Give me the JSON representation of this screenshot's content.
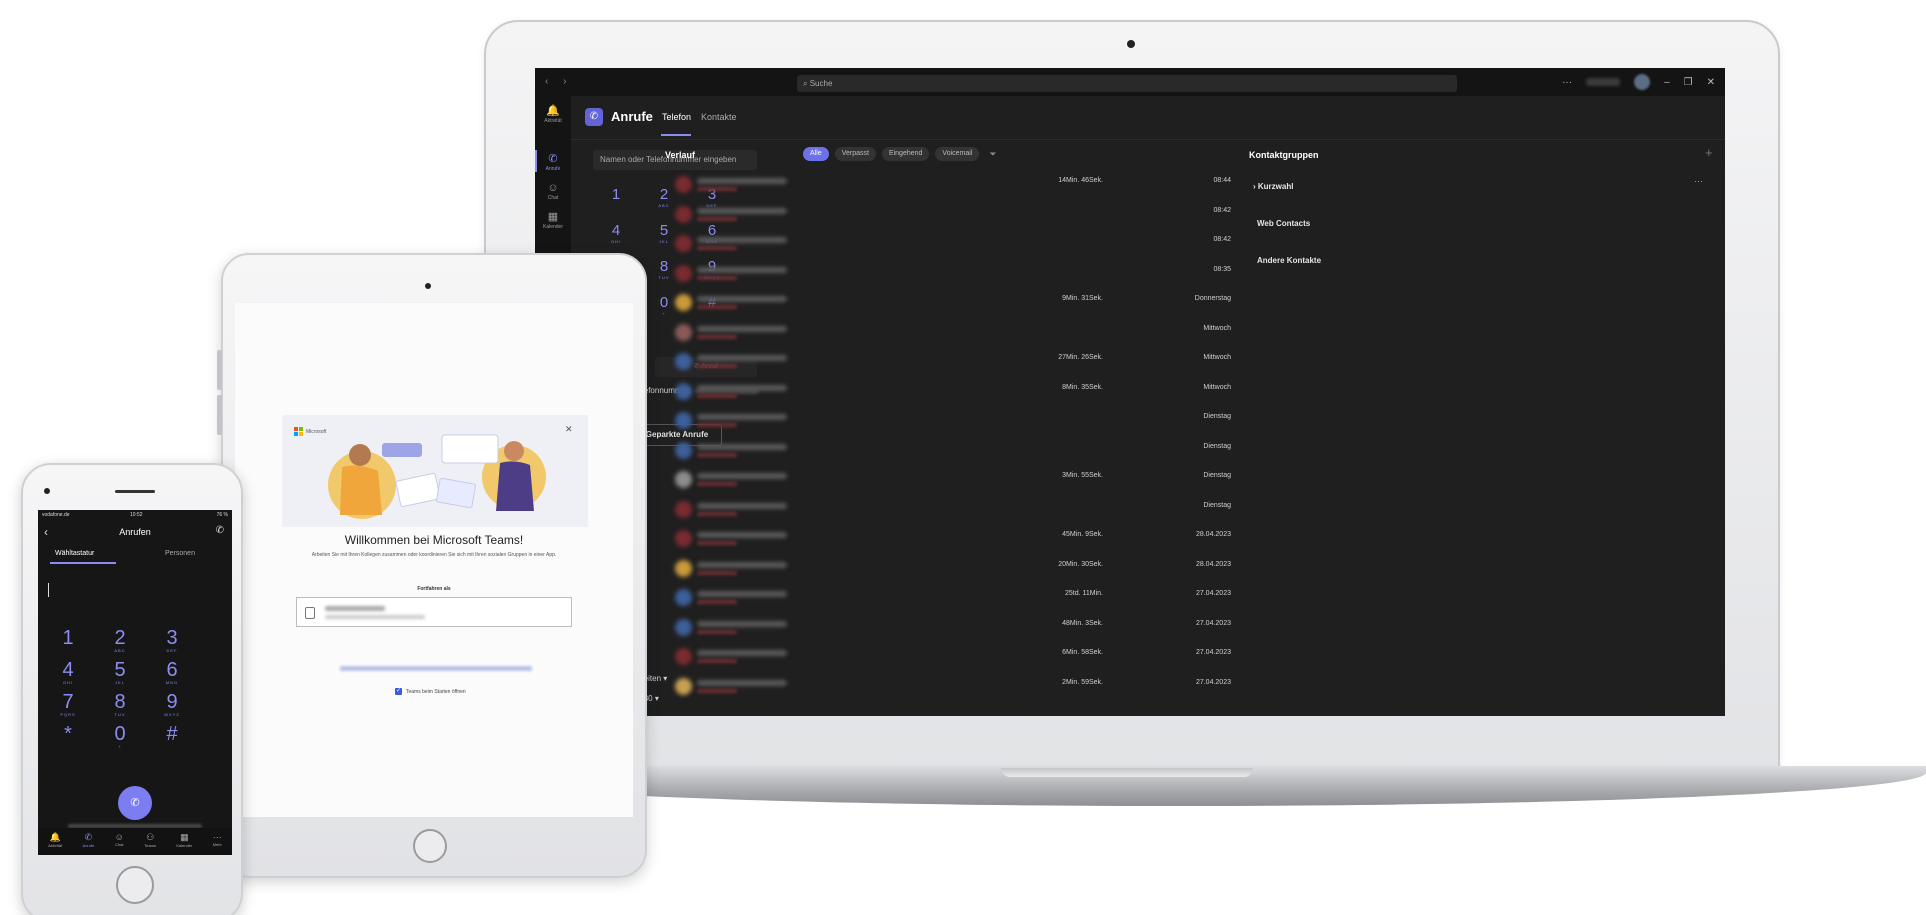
{
  "laptop": {
    "search_placeholder": "Suche",
    "nav_arrows": "‹ ›",
    "window_controls": [
      "···",
      "–",
      "❐",
      "✕"
    ],
    "rail": [
      {
        "label": "Aktivität",
        "icon": "bell-icon",
        "glyph": "🔔"
      },
      {
        "label": "Anrufe",
        "icon": "phone-icon",
        "glyph": "✆"
      },
      {
        "label": "Chat",
        "icon": "chat-icon",
        "glyph": "☺"
      },
      {
        "label": "Kalender",
        "icon": "calendar-icon",
        "glyph": "▦"
      }
    ],
    "app_title": "Anrufe",
    "tabs": [
      "Telefon",
      "Kontakte"
    ],
    "dial_placeholder": "Namen oder Telefonnummer eingeben",
    "keypad": [
      {
        "n": "1",
        "l": ""
      },
      {
        "n": "2",
        "l": "ABC"
      },
      {
        "n": "3",
        "l": "DEF"
      },
      {
        "n": "4",
        "l": "GHI"
      },
      {
        "n": "5",
        "l": "JKL"
      },
      {
        "n": "6",
        "l": "MNO"
      },
      {
        "n": "",
        "l": ""
      },
      {
        "n": "8",
        "l": "TUV"
      },
      {
        "n": "9",
        "l": "WXYZ"
      },
      {
        "n": "",
        "l": ""
      },
      {
        "n": "0",
        "l": "+"
      },
      {
        "n": "#",
        "l": ""
      }
    ],
    "call_button": "Anruf",
    "phone_number_label": "e Telefonnummer:",
    "parked_calls": "Geparkte Anrufe",
    "bottom_select_1": "deleiten",
    "bottom_select_2": "k 380",
    "history_title": "Verlauf",
    "filters": [
      "Alle",
      "Verpasst",
      "Eingehend",
      "Voicemail"
    ],
    "history": [
      {
        "duration": "14Min. 46Sek.",
        "time": "08:44",
        "avatar": "#7a2b30"
      },
      {
        "duration": "",
        "time": "08:42",
        "avatar": "#7a2b30"
      },
      {
        "duration": "",
        "time": "08:42",
        "avatar": "#7a2b30"
      },
      {
        "duration": "",
        "time": "08:35",
        "avatar": "#7a2b30"
      },
      {
        "duration": "9Min. 31Sek.",
        "time": "Donnerstag",
        "avatar": "#c89a3a"
      },
      {
        "duration": "",
        "time": "Mittwoch",
        "avatar": "#8a5a5a"
      },
      {
        "duration": "27Min. 26Sek.",
        "time": "Mittwoch",
        "avatar": "#3d5f9a"
      },
      {
        "duration": "8Min. 35Sek.",
        "time": "Mittwoch",
        "avatar": "#3d5f9a"
      },
      {
        "duration": "",
        "time": "Dienstag",
        "avatar": "#3d5f9a"
      },
      {
        "duration": "",
        "time": "Dienstag",
        "avatar": "#3d5f9a"
      },
      {
        "duration": "3Min. 55Sek.",
        "time": "Dienstag",
        "avatar": "#8d8d8d"
      },
      {
        "duration": "",
        "time": "Dienstag",
        "avatar": "#7a2b30"
      },
      {
        "duration": "45Min. 9Sek.",
        "time": "28.04.2023",
        "avatar": "#7a2b30"
      },
      {
        "duration": "20Min. 30Sek.",
        "time": "28.04.2023",
        "avatar": "#c89a3a"
      },
      {
        "duration": "25td. 11Min.",
        "time": "27.04.2023",
        "avatar": "#3d5f9a"
      },
      {
        "duration": "48Min. 3Sek.",
        "time": "27.04.2023",
        "avatar": "#3d5f9a"
      },
      {
        "duration": "6Min. 58Sek.",
        "time": "27.04.2023",
        "avatar": "#7a2b30"
      },
      {
        "duration": "2Min. 59Sek.",
        "time": "27.04.2023",
        "avatar": "#c8a050"
      }
    ],
    "contact_groups_title": "Kontaktgruppen",
    "contact_groups": [
      "Kurzwahl",
      "Web Contacts",
      "Andere Kontakte"
    ]
  },
  "tablet": {
    "brand": "Microsoft",
    "welcome_title": "Willkommen bei Microsoft Teams!",
    "welcome_sub": "Arbeiten Sie mit Ihren Kollegen zusammen oder koordinieren Sie sich mit Ihren sozialen Gruppen in einer App.",
    "continue_label": "Fortfahren als",
    "launch_label": "Teams beim Starten öffnen"
  },
  "phone": {
    "status_left": "vodafone.de",
    "status_time": "10:52",
    "status_right": "76 %",
    "title": "Anrufen",
    "tabs": [
      "Wähltastatur",
      "Personen"
    ],
    "keypad": [
      {
        "n": "1",
        "l": ""
      },
      {
        "n": "2",
        "l": "ABC"
      },
      {
        "n": "3",
        "l": "DEF"
      },
      {
        "n": "4",
        "l": "GHI"
      },
      {
        "n": "5",
        "l": "JKL"
      },
      {
        "n": "6",
        "l": "MNO"
      },
      {
        "n": "7",
        "l": "PQRS"
      },
      {
        "n": "8",
        "l": "TUV"
      },
      {
        "n": "9",
        "l": "WXYZ"
      },
      {
        "n": "*",
        "l": ""
      },
      {
        "n": "0",
        "l": "+"
      },
      {
        "n": "#",
        "l": ""
      }
    ],
    "nav": [
      {
        "label": "Aktivität",
        "glyph": "🔔",
        "icon": "bell-icon"
      },
      {
        "label": "Anrufe",
        "glyph": "✆",
        "icon": "phone-icon"
      },
      {
        "label": "Chat",
        "glyph": "☺",
        "icon": "chat-icon"
      },
      {
        "label": "Teams",
        "glyph": "⚇",
        "icon": "teams-icon"
      },
      {
        "label": "Kalender",
        "glyph": "▦",
        "icon": "calendar-icon"
      },
      {
        "label": "Mehr",
        "glyph": "···",
        "icon": "more-icon"
      }
    ]
  },
  "colors": {
    "accent": "#8b8df0",
    "dark_bg": "#1f1f1f",
    "rail_bg": "#141414"
  }
}
